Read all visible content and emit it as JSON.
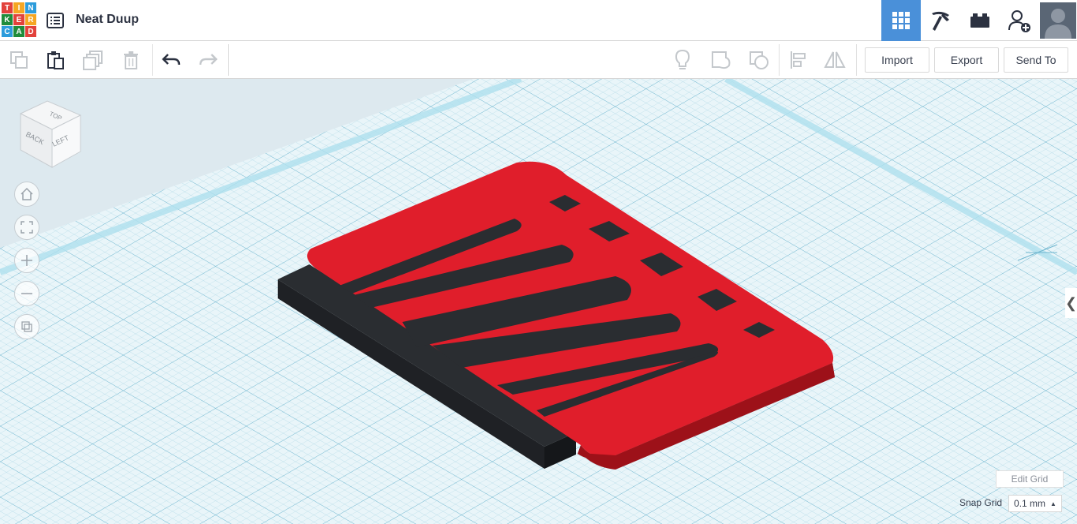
{
  "logo": {
    "letters": [
      "T",
      "I",
      "N",
      "K",
      "E",
      "R",
      "C",
      "A",
      "D"
    ],
    "colors": [
      "#e2423c",
      "#f5a623",
      "#2d9cdb",
      "#1f8c3b",
      "#e2423c",
      "#f5a623",
      "#2d9cdb",
      "#1f8c3b",
      "#e2423c"
    ]
  },
  "design": {
    "title": "Neat Duup"
  },
  "header": {
    "icons": [
      "grid-view-icon",
      "pickaxe-icon",
      "bricks-icon",
      "add-user-icon",
      "avatar"
    ]
  },
  "toolbar": {
    "import_label": "Import",
    "export_label": "Export",
    "send_to_label": "Send To"
  },
  "viewcube": {
    "top": "TOP",
    "back": "BACK",
    "left": "LEFT"
  },
  "grid": {
    "edit_label": "Edit Grid",
    "snap_label": "Snap Grid",
    "snap_value": "0.1 mm",
    "snap_arrow": "▲"
  },
  "panel": {
    "collapse_glyph": "❮"
  },
  "colors": {
    "accent": "#4a90d9",
    "workplane": "#dde9ef",
    "shape_red": "#e01e2b",
    "shape_dark": "#2a2d31"
  }
}
